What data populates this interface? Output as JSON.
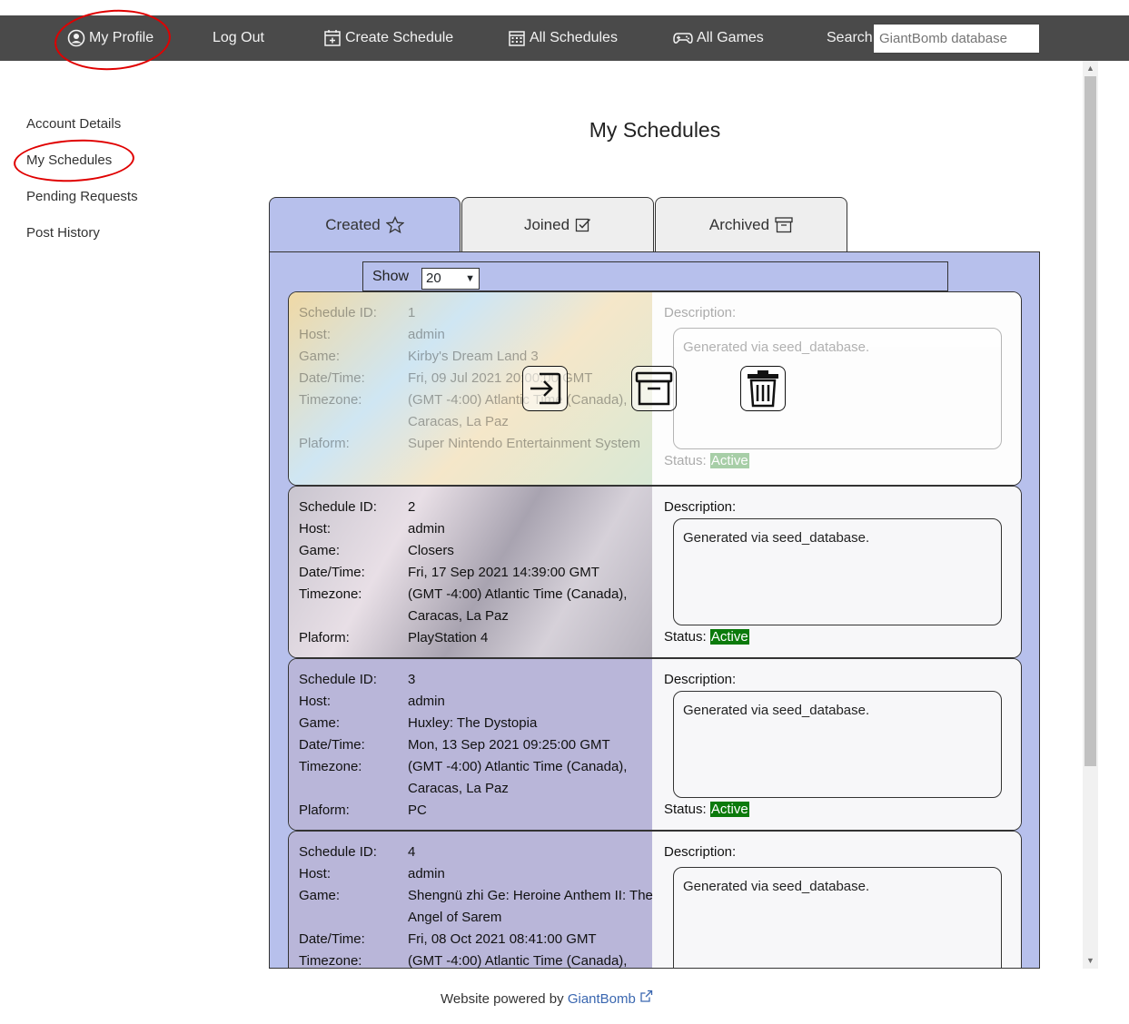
{
  "nav": {
    "profile": "My Profile",
    "logout": "Log Out",
    "create": "Create Schedule",
    "all_schedules": "All Schedules",
    "all_games": "All Games",
    "search_label": "Search",
    "search_placeholder": "GiantBomb database"
  },
  "sidebar": {
    "items": [
      {
        "label": "Account Details"
      },
      {
        "label": "My Schedules"
      },
      {
        "label": "Pending Requests"
      },
      {
        "label": "Post History"
      }
    ]
  },
  "page": {
    "title": "My Schedules"
  },
  "tabs": [
    {
      "label": "Created",
      "icon": "star-icon"
    },
    {
      "label": "Joined",
      "icon": "check-square-icon"
    },
    {
      "label": "Archived",
      "icon": "archive-icon"
    }
  ],
  "show": {
    "label": "Show",
    "value": "20"
  },
  "field_labels": {
    "id": "Schedule ID:",
    "host": "Host:",
    "game": "Game:",
    "datetime": "Date/Time:",
    "timezone": "Timezone:",
    "platform": "Plaform:",
    "description": "Description:",
    "status": "Status:"
  },
  "schedules": [
    {
      "id": "1",
      "host": "admin",
      "game": "Kirby's Dream Land 3",
      "datetime": "Fri, 09 Jul 2021 20:00:00 GMT",
      "timezone": "(GMT -4:00) Atlantic Time (Canada), Caracas, La Paz",
      "platform": "Super Nintendo Entertainment System",
      "description": "Generated via seed_database.",
      "status": "Active"
    },
    {
      "id": "2",
      "host": "admin",
      "game": "Closers",
      "datetime": "Fri, 17 Sep 2021 14:39:00 GMT",
      "timezone": "(GMT -4:00) Atlantic Time (Canada), Caracas, La Paz",
      "platform": "PlayStation 4",
      "description": "Generated via seed_database.",
      "status": "Active"
    },
    {
      "id": "3",
      "host": "admin",
      "game": "Huxley: The Dystopia",
      "datetime": "Mon, 13 Sep 2021 09:25:00 GMT",
      "timezone": "(GMT -4:00) Atlantic Time (Canada), Caracas, La Paz",
      "platform": "PC",
      "description": "Generated via seed_database.",
      "status": "Active"
    },
    {
      "id": "4",
      "host": "admin",
      "game": "Shengnü zhi Ge: Heroine Anthem II: The Angel of Sarem",
      "datetime": "Fri, 08 Oct 2021 08:41:00 GMT",
      "timezone": "(GMT -4:00) Atlantic Time (Canada),",
      "description": "Generated via seed_database."
    }
  ],
  "footer": {
    "text": "Website powered by",
    "link": "GiantBomb"
  },
  "colors": {
    "nav_bg": "#4a4a4a",
    "panel_bg": "#b7c0ec",
    "status_active": "#0b7a0b",
    "annotation": "#e00000"
  }
}
